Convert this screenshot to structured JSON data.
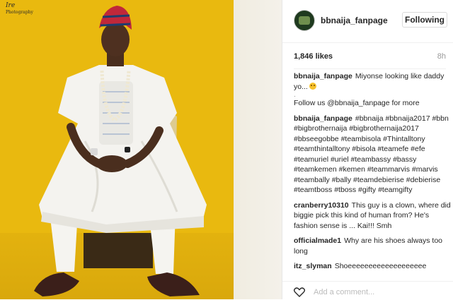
{
  "photo": {
    "watermark": "Ire",
    "watermark_sub": "Photography"
  },
  "header": {
    "username": "bbnaija_fanpage",
    "follow_label": "Following"
  },
  "stats": {
    "likes": "1,846 likes",
    "time": "8h"
  },
  "caption": {
    "user": "bbnaija_fanpage",
    "text": "Miyonse looking like daddy yo...",
    "dot": ".",
    "follow_text": "Follow us @bbnaija_fanpage for more"
  },
  "hashtags": {
    "user": "bbnaija_fanpage",
    "text": "#bbnaija #bbnaija2017 #bbn #bigbrothernaija #bigbrothernaija2017 #bbseegobbe #teambisola #Thintalltony #teamthintalltony #bisola #teamefe #efe #teamuriel #uriel #teambassy #bassy #teamkemen #kemen #teammarvis #marvis #teambally #bally #teamdebierise #debierise #teamtboss #tboss #gifty #teamgifty"
  },
  "comments": [
    {
      "user": "cranberry10310",
      "text": "This guy is a clown, where did biggie pick this kind of human from? He's fashion sense is ... Kai!!! Smh"
    },
    {
      "user": "officialmade1",
      "text": "Why are his shoes always too long"
    },
    {
      "user": "itz_slyman",
      "text": "Shoeeeeeeeeeeeeeeeeeee"
    }
  ],
  "footer": {
    "add_comment_placeholder": "Add a comment..."
  },
  "colors": {
    "photo_background": "#e9b90f",
    "text": "#262626",
    "muted": "#999999"
  }
}
